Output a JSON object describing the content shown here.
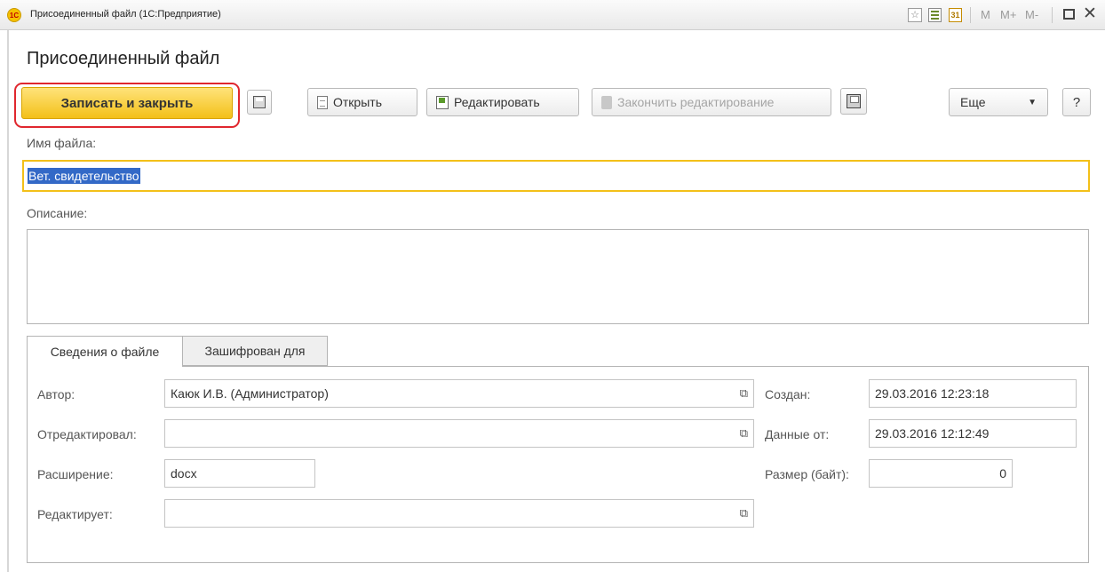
{
  "window": {
    "title": "Присоединенный файл  (1С:Предприятие)",
    "logo_text": "1С",
    "calendar_label": "31",
    "mem_buttons": [
      "M",
      "M+",
      "M-"
    ]
  },
  "page_title": "Присоединенный файл",
  "toolbar": {
    "save_close": "Записать и закрыть",
    "open": "Открыть",
    "edit": "Редактировать",
    "finish_edit": "Закончить редактирование",
    "more": "Еще",
    "help": "?"
  },
  "filename": {
    "label": "Имя файла:",
    "value": "Вет. свидетельство"
  },
  "description": {
    "label": "Описание:",
    "value": ""
  },
  "tabs": [
    "Сведения о файле",
    "Зашифрован для"
  ],
  "info": {
    "author_label": "Автор:",
    "author_value": "Каюк И.В. (Администратор)",
    "editedby_label": "Отредактировал:",
    "editedby_value": "",
    "extension_label": "Расширение:",
    "extension_value": "docx",
    "editing_label": "Редактирует:",
    "editing_value": "",
    "created_label": "Создан:",
    "created_value": "29.03.2016 12:23:18",
    "datafrom_label": "Данные от:",
    "datafrom_value": "29.03.2016 12:12:49",
    "size_label": "Размер (байт):",
    "size_value": "0"
  },
  "colors": {
    "accent": "#f3c019",
    "highlight": "#e0272e",
    "selection": "#3369c7"
  },
  "icons": {
    "open_ref": "open-form-icon",
    "save": "floppy-icon",
    "open": "document-icon",
    "edit": "edit-document-icon",
    "finish": "finish-edit-icon",
    "save_file": "save-to-disk-icon",
    "more": "dropdown-arrow-icon"
  }
}
